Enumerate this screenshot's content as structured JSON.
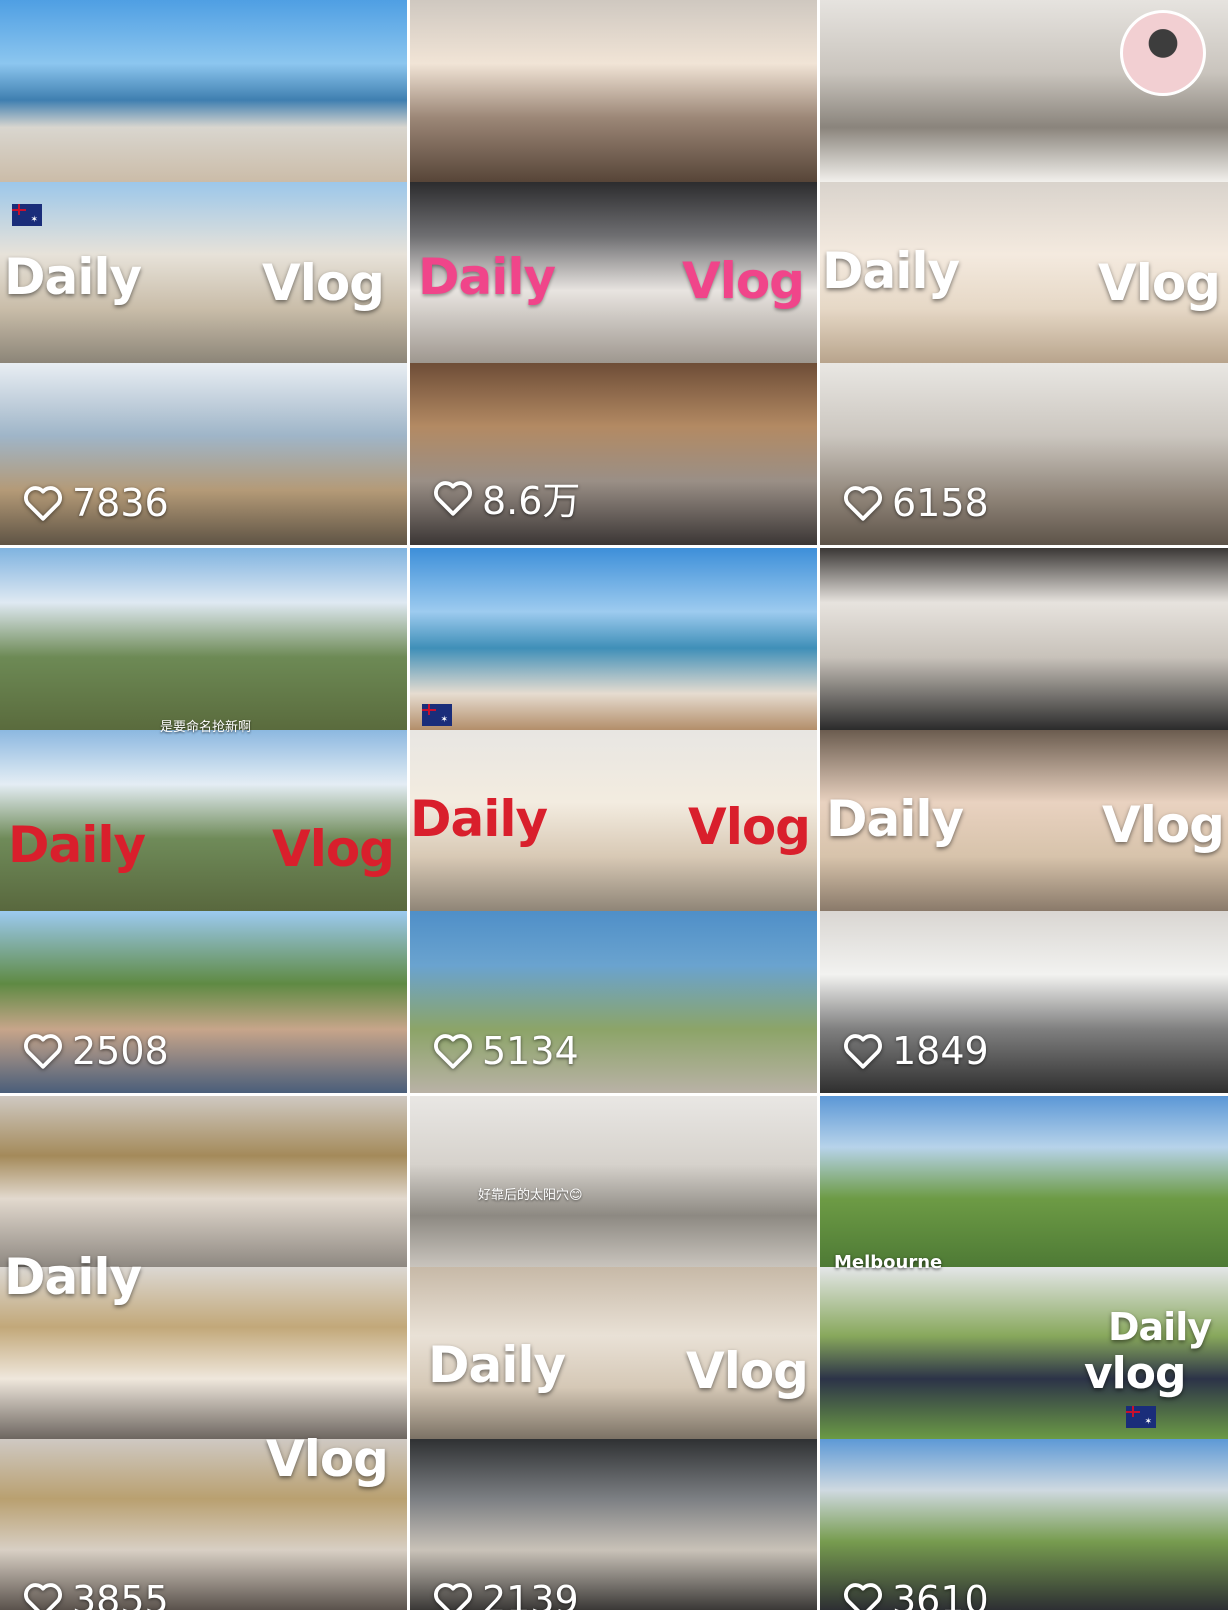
{
  "colors": {
    "white_text": "#ffffff",
    "pink_text": "#f0458a",
    "red_text": "#d91f2c"
  },
  "cards": [
    {
      "likes": "7836",
      "overlay": [
        "Daily",
        "Vlog"
      ],
      "overlay_color": "white"
    },
    {
      "likes": "8.6万",
      "overlay": [
        "Daily",
        "Vlog"
      ],
      "overlay_color": "pink"
    },
    {
      "likes": "6158",
      "overlay": [
        "Daily",
        "Vlog"
      ],
      "overlay_color": "white"
    },
    {
      "likes": "2508",
      "overlay": [
        "Daily",
        "Vlog"
      ],
      "overlay_color": "red",
      "caption": "是要命名抢新啊"
    },
    {
      "likes": "5134",
      "overlay": [
        "Daily",
        "Vlog"
      ],
      "overlay_color": "red"
    },
    {
      "likes": "1849",
      "overlay": [
        "Daily",
        "Vlog"
      ],
      "overlay_color": "white"
    },
    {
      "likes": "3855",
      "overlay": [
        "Daily",
        "Vlog"
      ],
      "overlay_color": "white"
    },
    {
      "likes": "2139",
      "overlay": [
        "Daily",
        "Vlog"
      ],
      "overlay_color": "white",
      "caption": "好靠后的太阳穴😊"
    },
    {
      "likes": "3610",
      "overlay": [
        "Daily",
        "vlog"
      ],
      "overlay_color": "white",
      "place": "Melbourne"
    }
  ]
}
